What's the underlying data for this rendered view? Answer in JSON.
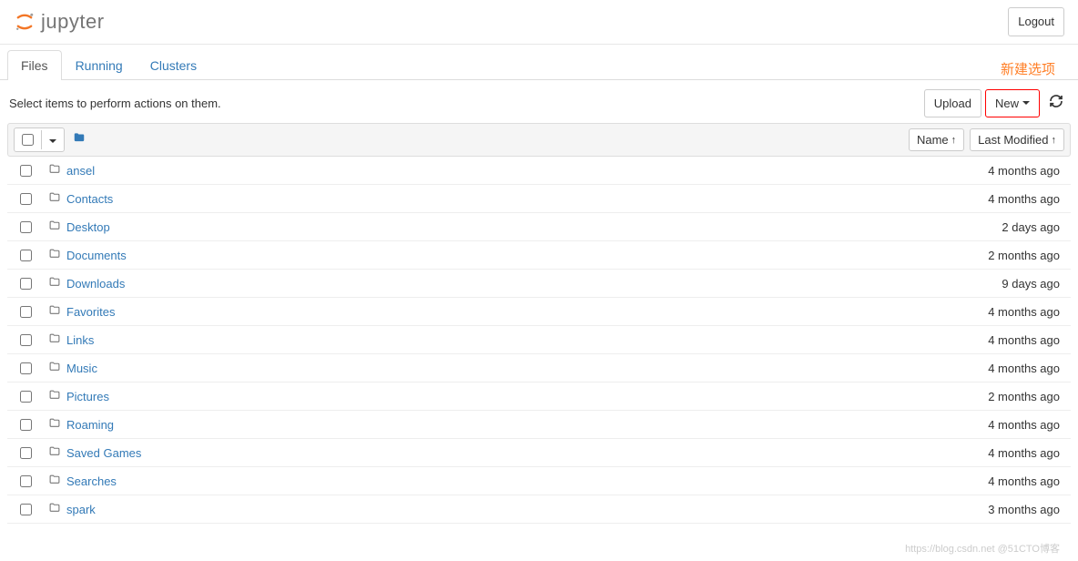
{
  "header": {
    "logo_text": "jupyter",
    "logout_label": "Logout"
  },
  "tabs": [
    {
      "label": "Files",
      "active": true
    },
    {
      "label": "Running",
      "active": false
    },
    {
      "label": "Clusters",
      "active": false
    }
  ],
  "annotation": "新建选项",
  "subheader": {
    "hint": "Select items to perform actions on them.",
    "upload_label": "Upload",
    "new_label": "New"
  },
  "list_header": {
    "name_label": "Name",
    "modified_label": "Last Modified"
  },
  "files": [
    {
      "name": "ansel",
      "modified": "4 months ago"
    },
    {
      "name": "Contacts",
      "modified": "4 months ago"
    },
    {
      "name": "Desktop",
      "modified": "2 days ago"
    },
    {
      "name": "Documents",
      "modified": "2 months ago"
    },
    {
      "name": "Downloads",
      "modified": "9 days ago"
    },
    {
      "name": "Favorites",
      "modified": "4 months ago"
    },
    {
      "name": "Links",
      "modified": "4 months ago"
    },
    {
      "name": "Music",
      "modified": "4 months ago"
    },
    {
      "name": "Pictures",
      "modified": "2 months ago"
    },
    {
      "name": "Roaming",
      "modified": "4 months ago"
    },
    {
      "name": "Saved Games",
      "modified": "4 months ago"
    },
    {
      "name": "Searches",
      "modified": "4 months ago"
    },
    {
      "name": "spark",
      "modified": "3 months ago"
    }
  ],
  "watermark": "https://blog.csdn.net @51CTO博客"
}
